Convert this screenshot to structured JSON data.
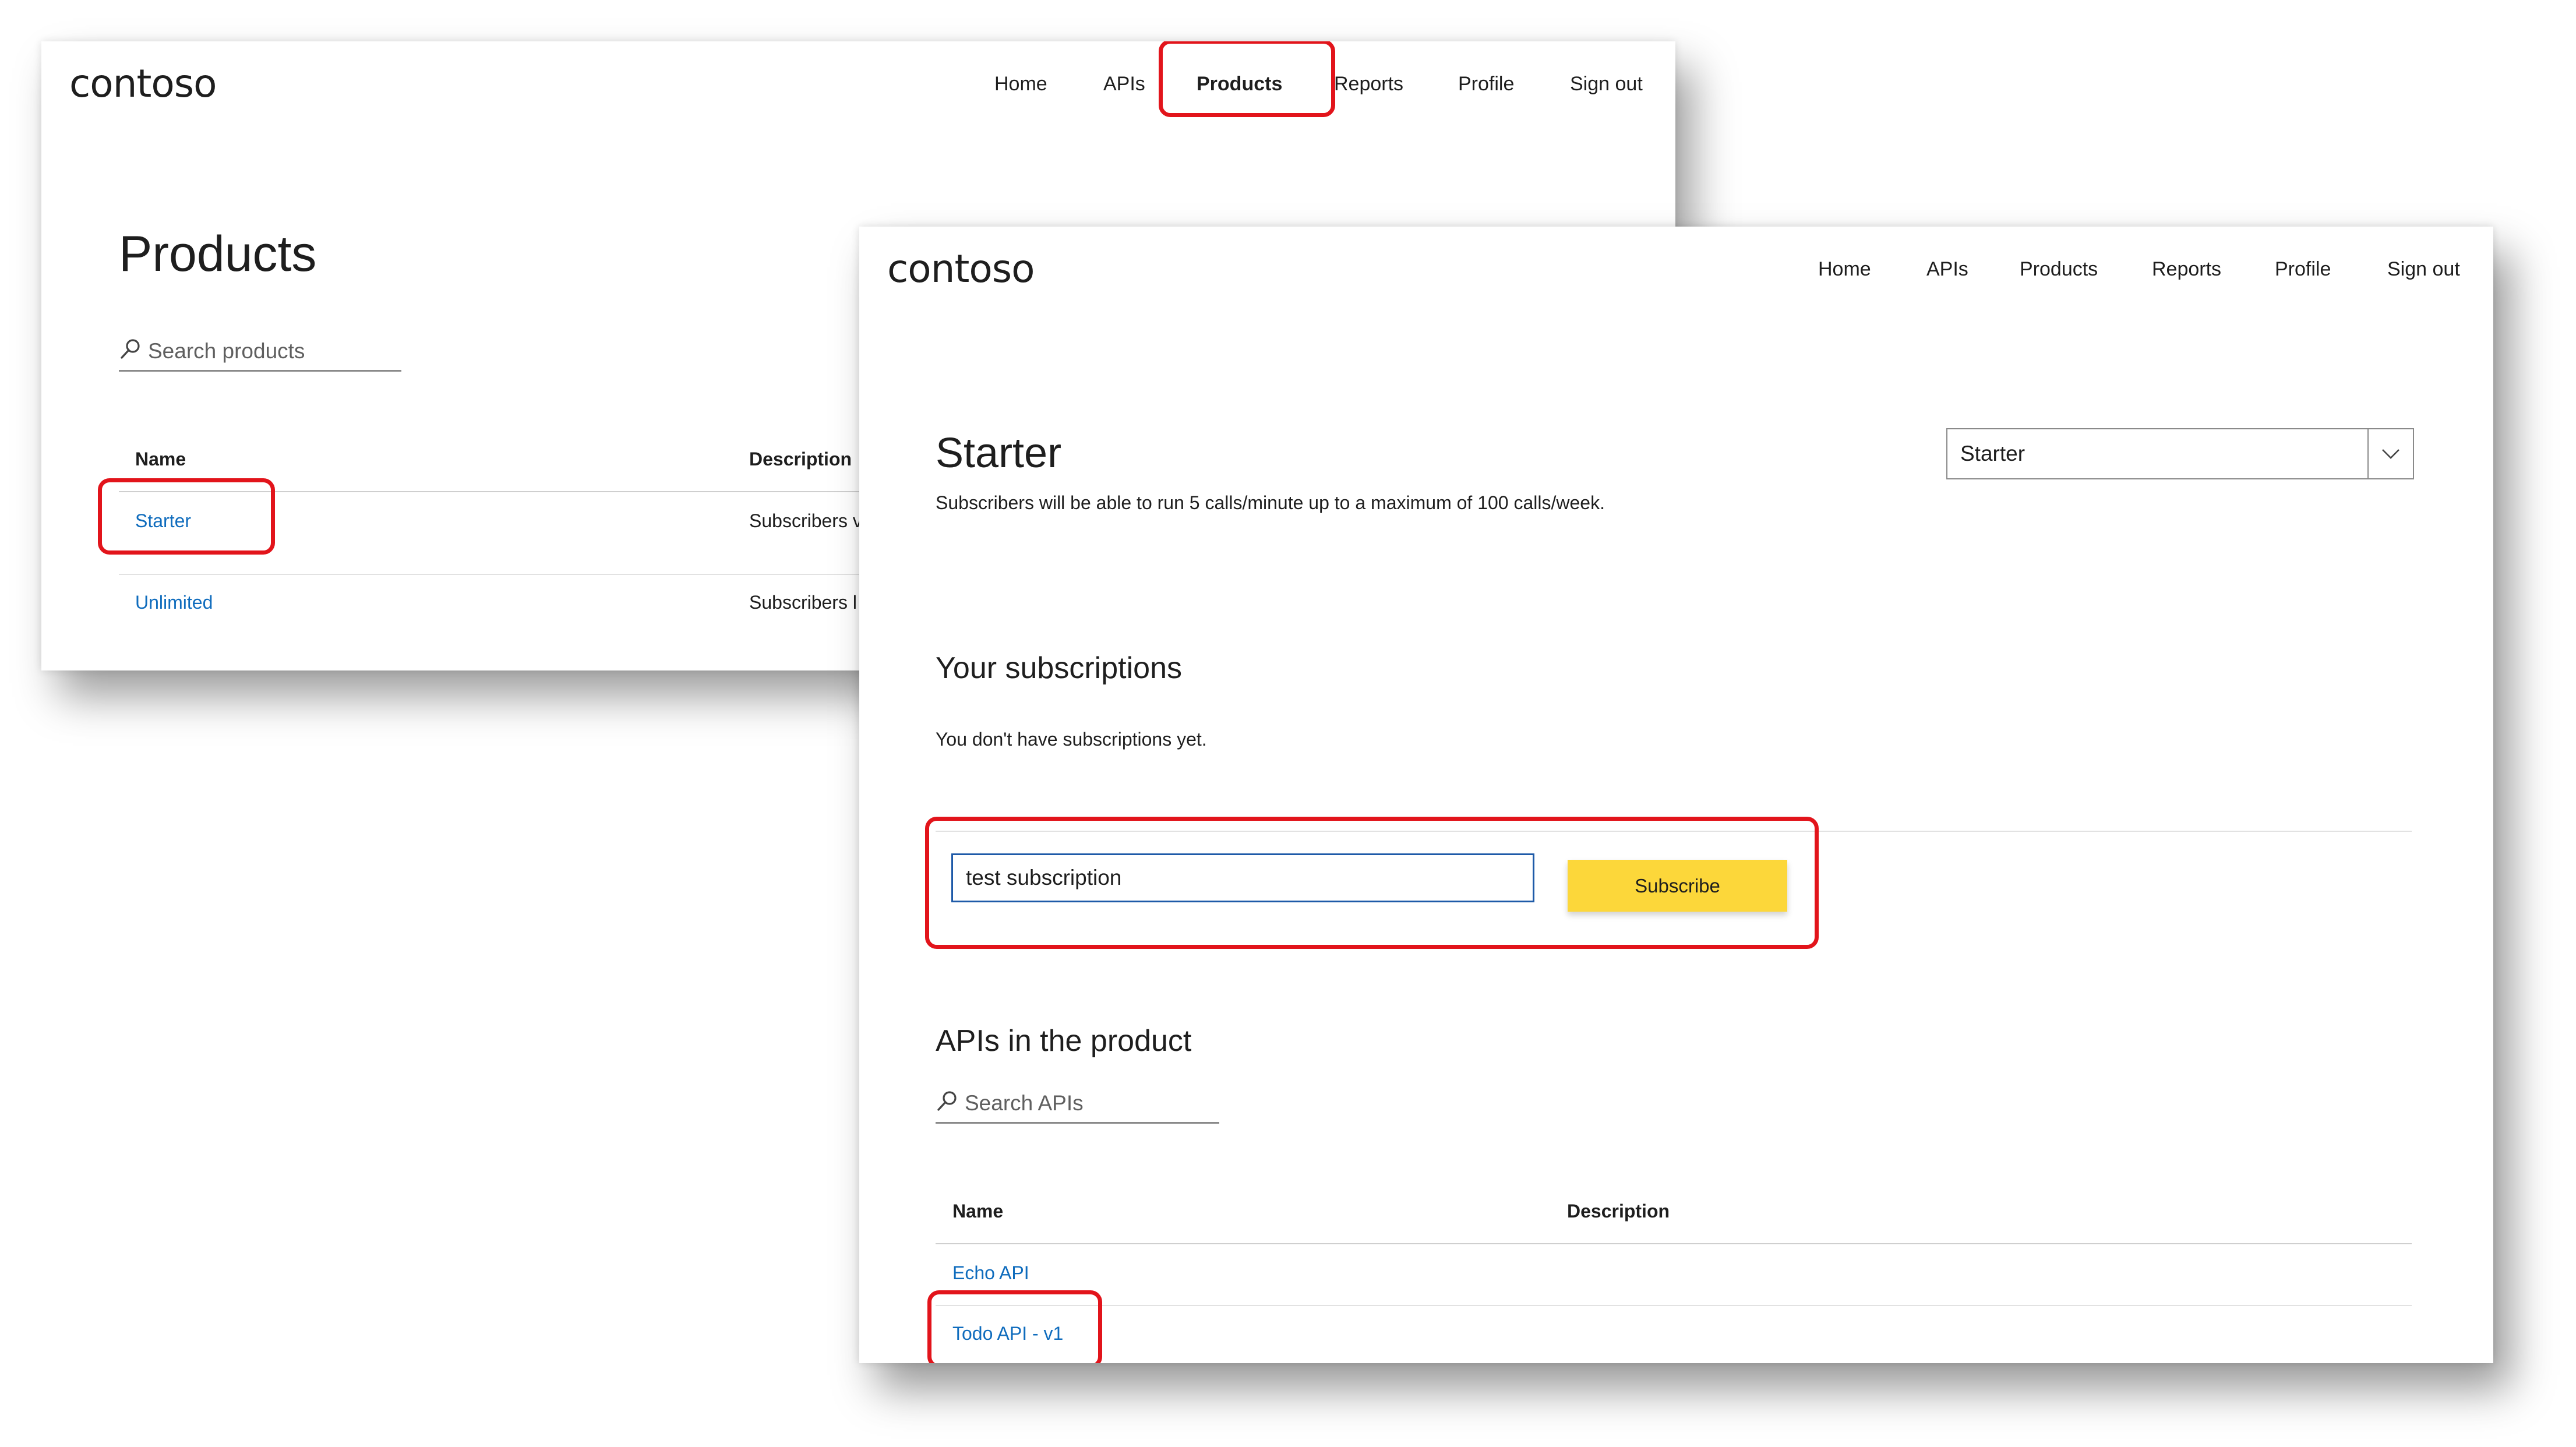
{
  "back_window": {
    "logo": "contoso",
    "nav": {
      "home": "Home",
      "apis": "APIs",
      "products": "Products",
      "reports": "Reports",
      "profile": "Profile",
      "sign_out": "Sign out",
      "active": "Products"
    },
    "page_title": "Products",
    "search": {
      "placeholder": "Search products"
    },
    "table": {
      "headers": {
        "name": "Name",
        "description": "Description"
      },
      "rows": [
        {
          "name": "Starter",
          "description": "Subscribers v"
        },
        {
          "name": "Unlimited",
          "description": "Subscribers l"
        }
      ]
    }
  },
  "front_window": {
    "logo": "contoso",
    "nav": {
      "home": "Home",
      "apis": "APIs",
      "products": "Products",
      "reports": "Reports",
      "profile": "Profile",
      "sign_out": "Sign out"
    },
    "product_title": "Starter",
    "product_description": "Subscribers will be able to run 5 calls/minute up to a maximum of 100 calls/week.",
    "product_select": {
      "selected": "Starter"
    },
    "subscriptions": {
      "heading": "Your subscriptions",
      "empty_text": "You don't have subscriptions yet.",
      "input_value": "test subscription",
      "subscribe_label": "Subscribe"
    },
    "apis": {
      "heading": "APIs in the product",
      "search_placeholder": "Search APIs",
      "headers": {
        "name": "Name",
        "description": "Description"
      },
      "rows": [
        {
          "name": "Echo API"
        },
        {
          "name": "Todo API - v1"
        }
      ]
    }
  },
  "colors": {
    "highlight": "#e2141b",
    "link": "#0f6cbd",
    "primary_button": "#fcd73a",
    "input_border": "#1e5aa8"
  },
  "icons": {
    "search": "search-icon",
    "dropdown": "chevron-down-icon"
  }
}
